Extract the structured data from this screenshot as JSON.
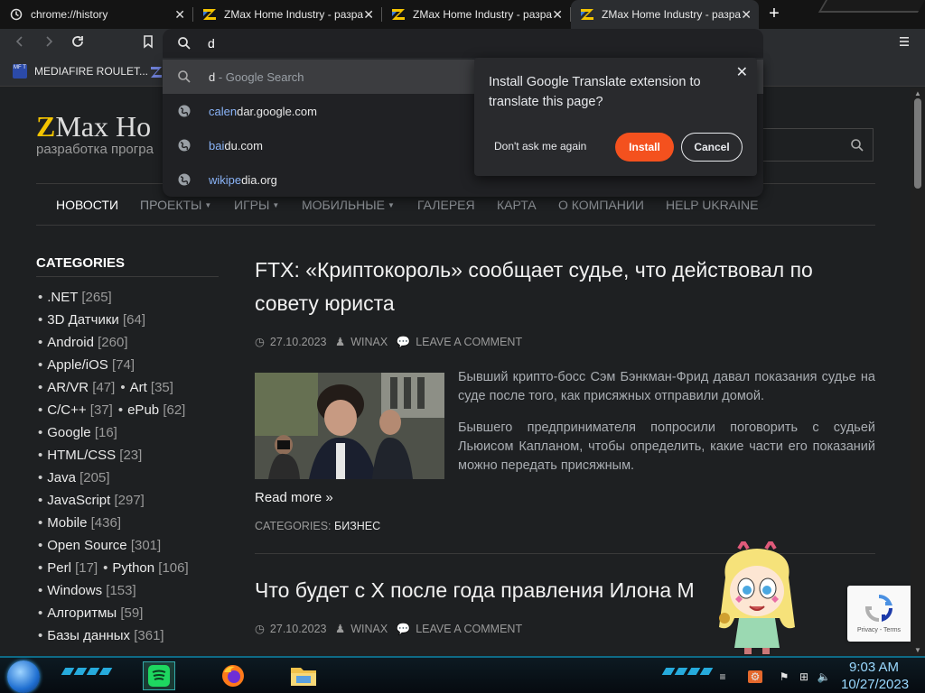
{
  "tabs": [
    {
      "title": "chrome://history",
      "favicon": "history-icon"
    },
    {
      "title": "ZMax Home Industry - разра",
      "favicon": "zmax-favicon"
    },
    {
      "title": "ZMax Home Industry - разра",
      "favicon": "zmax-favicon"
    },
    {
      "title": "ZMax Home Industry - разра",
      "favicon": "zmax-favicon"
    }
  ],
  "omnibox": {
    "value": "d"
  },
  "bookmarks": [
    {
      "label": "MEDIAFIRE ROULET...",
      "icon_text": "MF T"
    }
  ],
  "suggestions": [
    {
      "pre": "",
      "hl": "d",
      "post": "",
      "suffix": " - Google Search",
      "icon": "search-icon"
    },
    {
      "pre": "calen",
      "hl": "d",
      "post": "ar.google.com",
      "suffix": "",
      "icon": "globe-icon"
    },
    {
      "pre": "bai",
      "hl": "d",
      "post": "u.com",
      "suffix": "",
      "icon": "globe-icon"
    },
    {
      "pre": "wikipe",
      "hl": "d",
      "post": "ia.org",
      "suffix": "",
      "icon": "globe-icon"
    }
  ],
  "translate_popup": {
    "message": "Install Google Translate extension to translate this page?",
    "dont_ask": "Don't ask me again",
    "install": "Install",
    "cancel": "Cancel"
  },
  "site": {
    "logo_z": "Z",
    "logo_text": "Max Ho",
    "tagline": "разработка програ",
    "nav": [
      "НОВОСТИ",
      "ПРОЕКТЫ",
      "ИГРЫ",
      "МОБИЛЬНЫЕ",
      "ГАЛЕРЕЯ",
      "КАРТА",
      "О КОМПАНИИ",
      "HELP UKRAINE"
    ]
  },
  "sidebar": {
    "title": "CATEGORIES",
    "rows": [
      [
        {
          "name": ".NET",
          "count": "[265]"
        }
      ],
      [
        {
          "name": "3D Датчики",
          "count": "[64]"
        }
      ],
      [
        {
          "name": "Android",
          "count": "[260]"
        }
      ],
      [
        {
          "name": "Apple/iOS",
          "count": "[74]"
        }
      ],
      [
        {
          "name": "AR/VR",
          "count": "[47]"
        },
        {
          "name": "Art",
          "count": "[35]"
        }
      ],
      [
        {
          "name": "C/C++",
          "count": "[37]"
        },
        {
          "name": "ePub",
          "count": "[62]"
        }
      ],
      [
        {
          "name": "Google",
          "count": "[16]"
        }
      ],
      [
        {
          "name": "HTML/CSS",
          "count": "[23]"
        }
      ],
      [
        {
          "name": "Java",
          "count": "[205]"
        }
      ],
      [
        {
          "name": "JavaScript",
          "count": "[297]"
        }
      ],
      [
        {
          "name": "Mobile",
          "count": "[436]"
        }
      ],
      [
        {
          "name": "Open Source",
          "count": "[301]"
        }
      ],
      [
        {
          "name": "Perl",
          "count": "[17]"
        },
        {
          "name": "Python",
          "count": "[106]"
        }
      ],
      [
        {
          "name": "Windows",
          "count": "[153]"
        }
      ],
      [
        {
          "name": "Алгоритмы",
          "count": "[59]"
        }
      ],
      [
        {
          "name": "Базы данных",
          "count": "[361]"
        }
      ]
    ]
  },
  "posts": [
    {
      "title": "FTX: «Криптокороль» сообщает судье, что действовал по совету юриста",
      "date": "27.10.2023",
      "author": "WINAX",
      "comment": "LEAVE A COMMENT",
      "p1": "Бывший крипто-босс Сэм Бэнкман-Фрид давал показания судье на суде после того, как присяжных отправили домой.",
      "p2": "Бывшего предпринимателя попросили поговорить с судьей Льюисом Капланом, чтобы определить, какие части его показаний можно передать присяжным.",
      "readmore": "Read more »",
      "categories_label": "CATEGORIES:",
      "category": "БИЗНЕС"
    },
    {
      "title": "Что будет с X после года правления Илона М",
      "date": "27.10.2023",
      "author": "WINAX",
      "comment": "LEAVE A COMMENT"
    }
  ],
  "recaptcha": {
    "text": "Privacy - Terms"
  },
  "clock": {
    "time": "9:03 AM",
    "date": "10/27/2023"
  },
  "colors": {
    "accent": "#8ab4f8",
    "install": "#f4511e",
    "taskbar_glow": "#2bc6ff"
  }
}
